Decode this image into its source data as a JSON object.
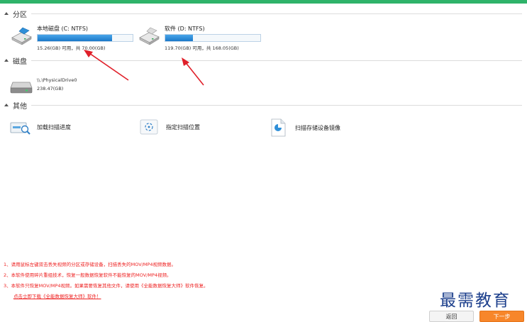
{
  "sections": {
    "partitions": "分区",
    "disks": "磁盘",
    "other": "其他"
  },
  "partitions": [
    {
      "name": "本地磁盘 (C: NTFS)",
      "info": "15.26(GB) 可用，共 70.00(GB)",
      "used_fraction": 0.78
    },
    {
      "name": "软件 (D: NTFS)",
      "info": "119.70(GB) 可用，共 168.05(GB)",
      "used_fraction": 0.29
    }
  ],
  "disk": {
    "name": "\\\\.\\PhysicalDrive0",
    "size": "238.47(GB)"
  },
  "tools": [
    {
      "label": "加载扫描进度",
      "icon": "load-scan-icon"
    },
    {
      "label": "指定扫描位置",
      "icon": "target-location-icon"
    },
    {
      "label": "扫描存储设备镜像",
      "icon": "image-file-icon"
    }
  ],
  "notes": [
    "1、请用鼠标左键双击丢失视频的分区或存储设备，扫描丢失的MOV/MP4视频数据。",
    "2、本软件使用碎片重组技术，恢复一般数据恢复软件不能恢复的MOV/MP4视频。",
    "3、本软件只恢复MOV/MP4视频。如果需要恢复其他文件，请使用《全能数据恢复大师》软件恢复。"
  ],
  "download_link": "点击立即下载《全能数据恢复大师》软件！",
  "watermark": "最需教育",
  "buttons": {
    "back": "返回",
    "next": "下一步"
  },
  "colors": {
    "accent_green": "#2fb36a",
    "progress_blue": "#1a78c8",
    "warning_red": "#e22222",
    "next_orange": "#f7862a",
    "annotation_red": "#e0202a"
  }
}
